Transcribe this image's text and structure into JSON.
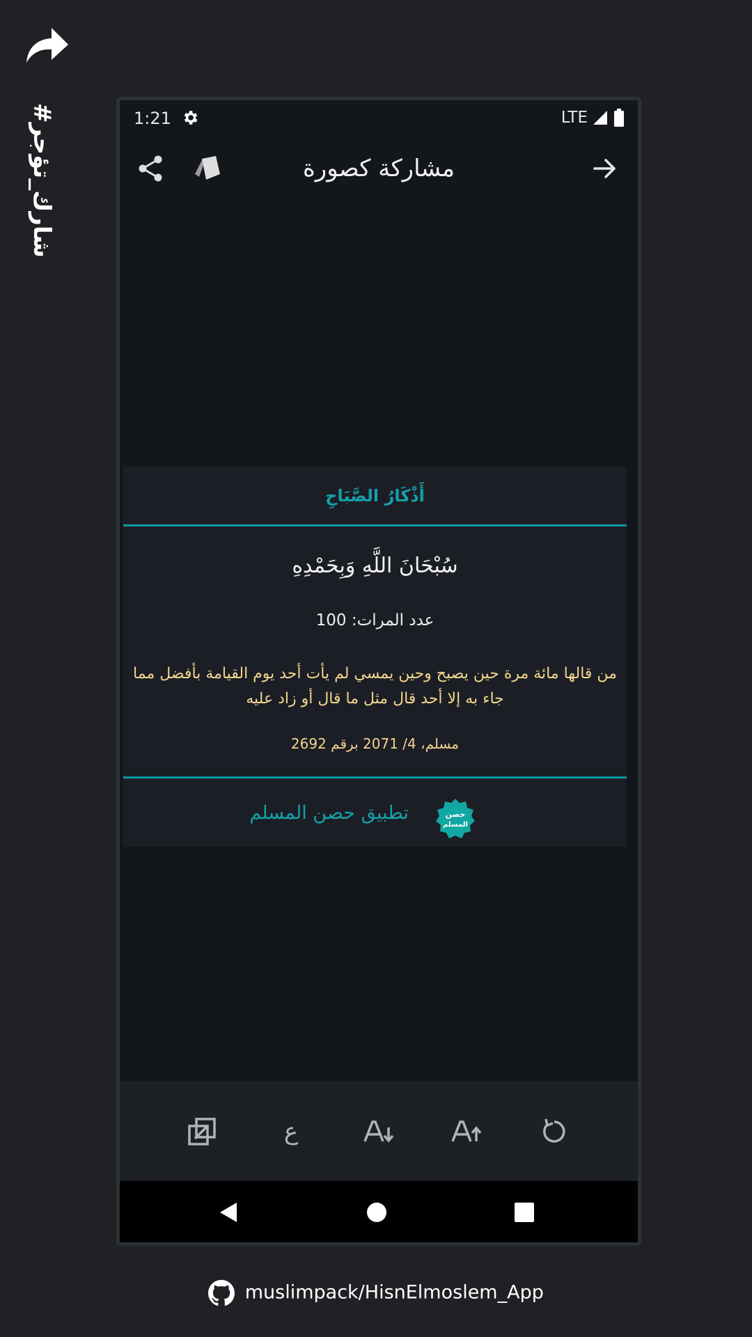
{
  "promo": {
    "hashtag": "#شارك_تؤجر",
    "github_text": "muslimpack/HisnElmoslem_App"
  },
  "status_bar": {
    "time": "1:21",
    "network": "LTE"
  },
  "app_bar": {
    "title": "مشاركة كصورة"
  },
  "card": {
    "title": "أَذْكَارُ الصَّبَاحِ",
    "zikr": "سُبْحَانَ اللَّهِ وَبِحَمْدِهِ",
    "count": "عدد المرات: 100",
    "fadl": "من قالها مائة مرة حين يصبح وحين يمسي لم يأت أحد يوم القيامة بأفضل مما جاء به إلا أحد قال مثل ما قال أو زاد عليه",
    "source": "مسلم، 4/ 2071 برقم 2692",
    "footer_label": "تطبيق حصن المسلم",
    "logo_text_1": "حصن",
    "logo_text_2": "المسلم"
  },
  "toolbar": {
    "icons": [
      "copy-icon",
      "arabic-letter-icon",
      "font-decrease-icon",
      "font-increase-icon",
      "reset-icon"
    ],
    "arabic_glyph": "ع"
  },
  "colors": {
    "accent": "#0e98a0",
    "gold_text": "#f3d68e",
    "background": "#13161a",
    "card": "#1c1e26"
  }
}
